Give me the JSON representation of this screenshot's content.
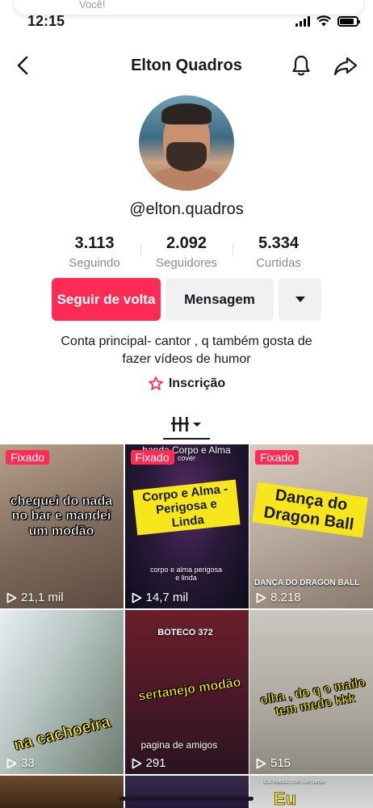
{
  "status": {
    "time": "12:15"
  },
  "notification": {
    "text": "Você!"
  },
  "header": {
    "title": "Elton Quadros"
  },
  "profile": {
    "handle": "@elton.quadros",
    "stats": [
      {
        "value": "3.113",
        "label": "Seguindo"
      },
      {
        "value": "2.092",
        "label": "Seguidores"
      },
      {
        "value": "5.334",
        "label": "Curtidas"
      }
    ],
    "buttons": {
      "follow": "Seguir de volta",
      "message": "Mensagem"
    },
    "bio_line1": "Conta principal- cantor , q também gosta de",
    "bio_line2": "fazer vídeos de humor",
    "subscription": "Inscrição"
  },
  "videos": [
    {
      "pinned": "Fixado",
      "views": "21,1 mil",
      "caption": "cheguei do nada no bar e mandei um modão",
      "colors": [
        "#b8a08a",
        "#5b4a3f"
      ]
    },
    {
      "pinned": "Fixado",
      "views": "14,7 mil",
      "caption": "Corpo e Alma - Perigosa e Linda",
      "top_text": "banda Corpo e Alma",
      "small_text": "cover",
      "bottom_text": "corpo e alma perigosa e linda",
      "colors": [
        "#2a1a3a",
        "#0c0c1a"
      ]
    },
    {
      "pinned": "Fixado",
      "views": "8.218",
      "caption": "Dança do Dragon Ball",
      "bottom_text": "DANÇA DO DRAGON BALL",
      "colors": [
        "#d7cbbf",
        "#8a7a6d"
      ]
    },
    {
      "views": "33",
      "caption": "na cachoeira",
      "colors": [
        "#e6eef0",
        "#6b7a6e"
      ]
    },
    {
      "views": "291",
      "caption": "sertanejo modão",
      "top_text": "BOTECO 372",
      "bottom_text": "pagina de amigos",
      "colors": [
        "#6a1f2a",
        "#2a1420"
      ]
    },
    {
      "views": "515",
      "caption": "olha , do q o mailo tem medo kkk",
      "colors": [
        "#c9c7c1",
        "#8e8a80"
      ]
    }
  ],
  "partial_row": [
    {
      "colors": [
        "#6e4a30",
        "#3b2818"
      ]
    },
    {
      "colors": [
        "#3a2a4a",
        "#22183a"
      ]
    },
    {
      "caption": "Eu",
      "top_text": "Eu mando com um amor",
      "colors": [
        "#bfbfbf",
        "#d8d8d8"
      ]
    }
  ]
}
